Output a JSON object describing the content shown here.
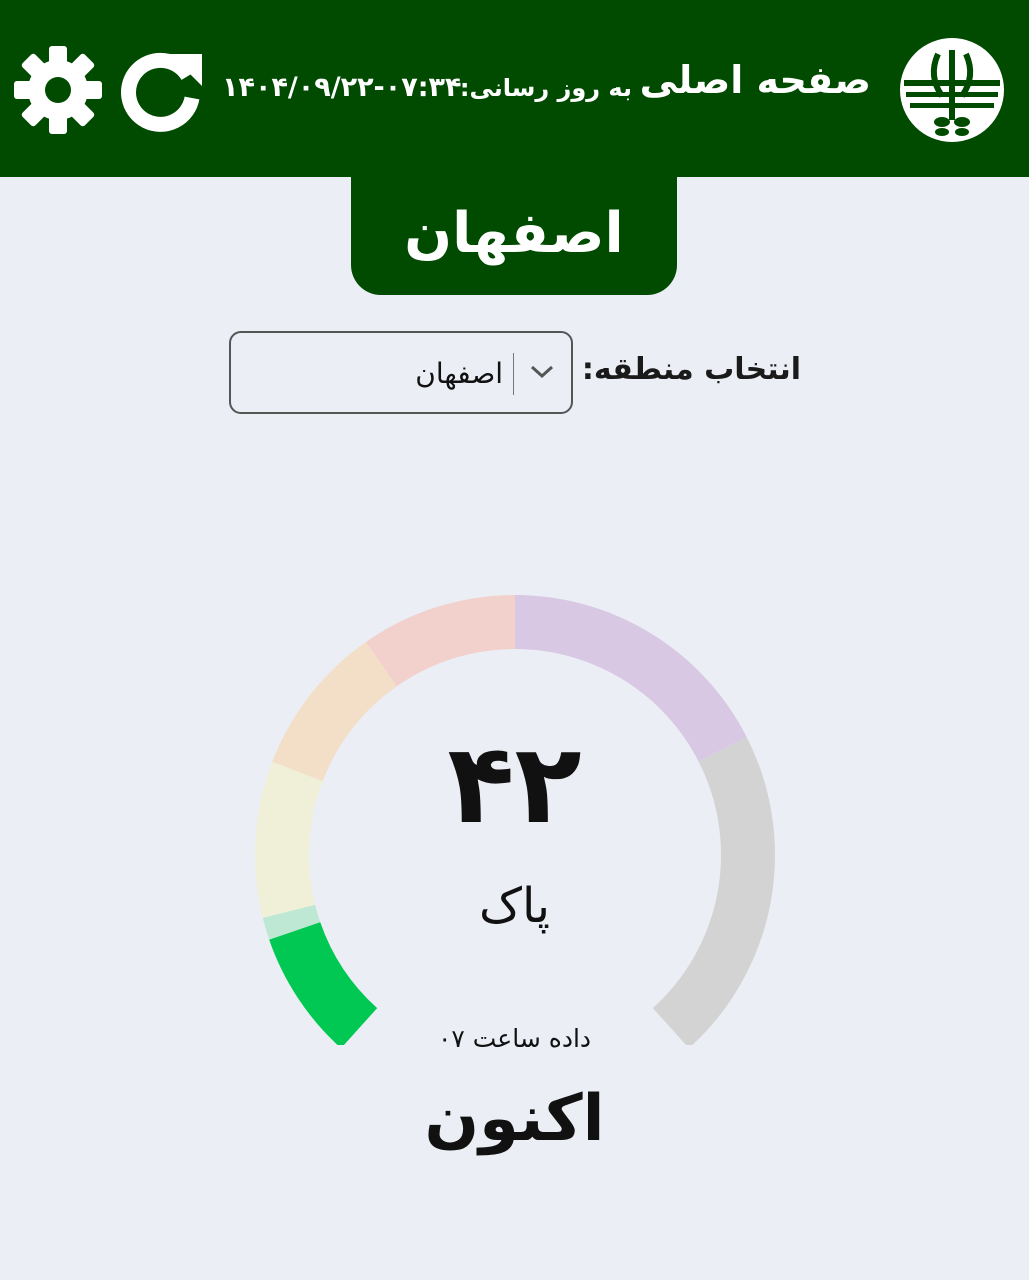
{
  "header": {
    "title": "صفحه اصلی",
    "updated_label": "به روز رسانی:",
    "updated_value": "۱۴۰۴/۰۹/۲۲-۰۷:۳۴",
    "refresh_icon": "refresh-icon",
    "settings_icon": "gear-icon",
    "logo_icon": "environment-logo-icon"
  },
  "city": {
    "name": "اصفهان"
  },
  "region": {
    "label": "انتخاب منطقه:",
    "selected": "اصفهان"
  },
  "gauge": {
    "value": "۴۲",
    "status": "پاک",
    "hour_data": "داده ساعت ۰۷",
    "now_label": "اکنون",
    "level": 42,
    "colors": {
      "good": "#00c853",
      "good_light": "#bfe8d4",
      "moderate": "#f0f0d8",
      "sensitive": "#f3dfc8",
      "unhealthy": "#f2d0cb",
      "very_unhealthy": "#d8c8e4",
      "hazardous": "#d3d3d3"
    }
  },
  "colors": {
    "brand": "#004b00",
    "background": "#ebeef4"
  }
}
